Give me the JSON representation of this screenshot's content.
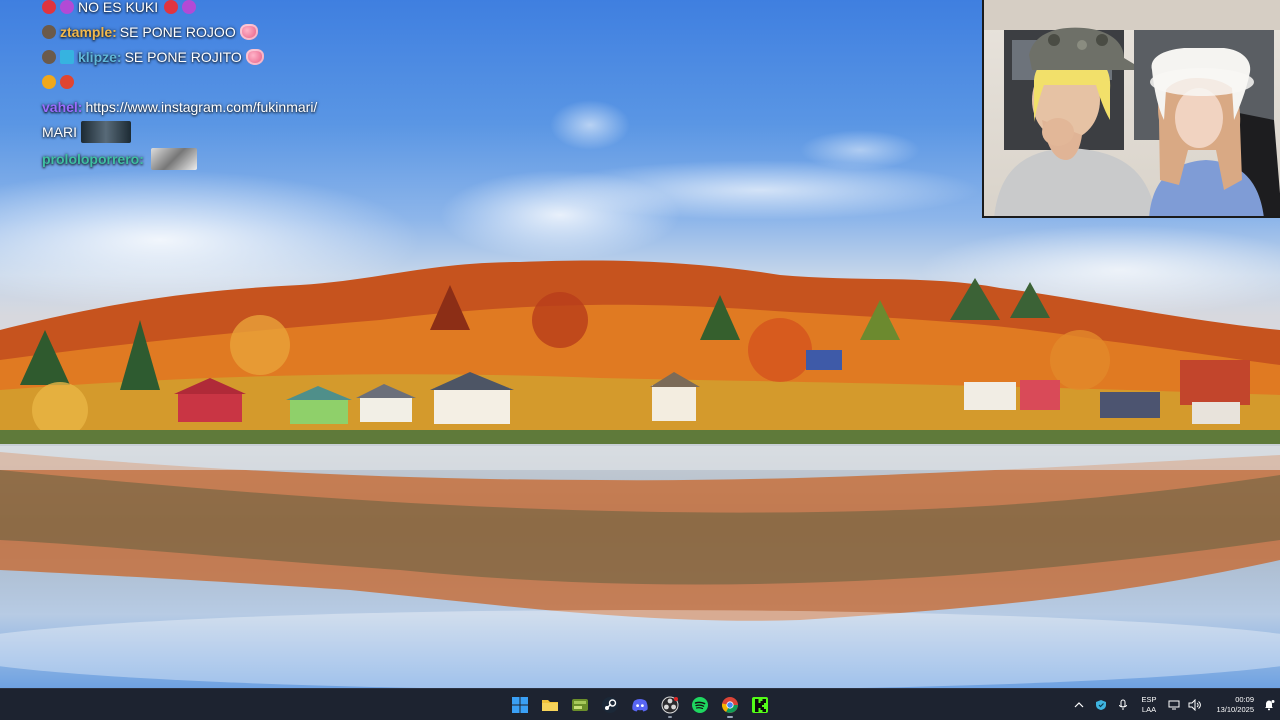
{
  "chat": {
    "lines": [
      {
        "user": "",
        "text": "NO ES KUKI",
        "user_color": "#ffffff"
      },
      {
        "user": "ztample:",
        "text": "SE PONE ROJOO",
        "user_color": "#f2b84b"
      },
      {
        "user": "klipze:",
        "text": "SE PONE ROJITO",
        "user_color": "#5fb6d9"
      },
      {
        "user": "",
        "text": "",
        "user_color": "#ffffff"
      },
      {
        "user": "vahel:",
        "text": "https://www.instagram.com/fukinmari/",
        "user_color": "#9b6cff"
      },
      {
        "user": "",
        "text": "MARI",
        "user_color": "#ffffff"
      },
      {
        "user": "prololoporrero:",
        "text": "",
        "user_color": "#3fbfa2"
      }
    ]
  },
  "taskbar": {
    "apps": [
      {
        "name": "start",
        "icon": "windows-logo-icon"
      },
      {
        "name": "file-explorer",
        "icon": "folder-icon"
      },
      {
        "name": "app-green",
        "icon": "green-app-icon"
      },
      {
        "name": "steam",
        "icon": "steam-icon"
      },
      {
        "name": "discord",
        "icon": "discord-icon"
      },
      {
        "name": "obs",
        "icon": "obs-icon"
      },
      {
        "name": "spotify",
        "icon": "spotify-icon"
      },
      {
        "name": "chrome",
        "icon": "chrome-icon"
      },
      {
        "name": "kick",
        "icon": "kick-icon"
      }
    ],
    "tray": {
      "language_top": "ESP",
      "language_bottom": "LAA",
      "time": "00:09",
      "date": "13/10/2025"
    }
  },
  "colors": {
    "taskbar_bg": "#1d2330",
    "sky_top": "#3f7fe0"
  }
}
